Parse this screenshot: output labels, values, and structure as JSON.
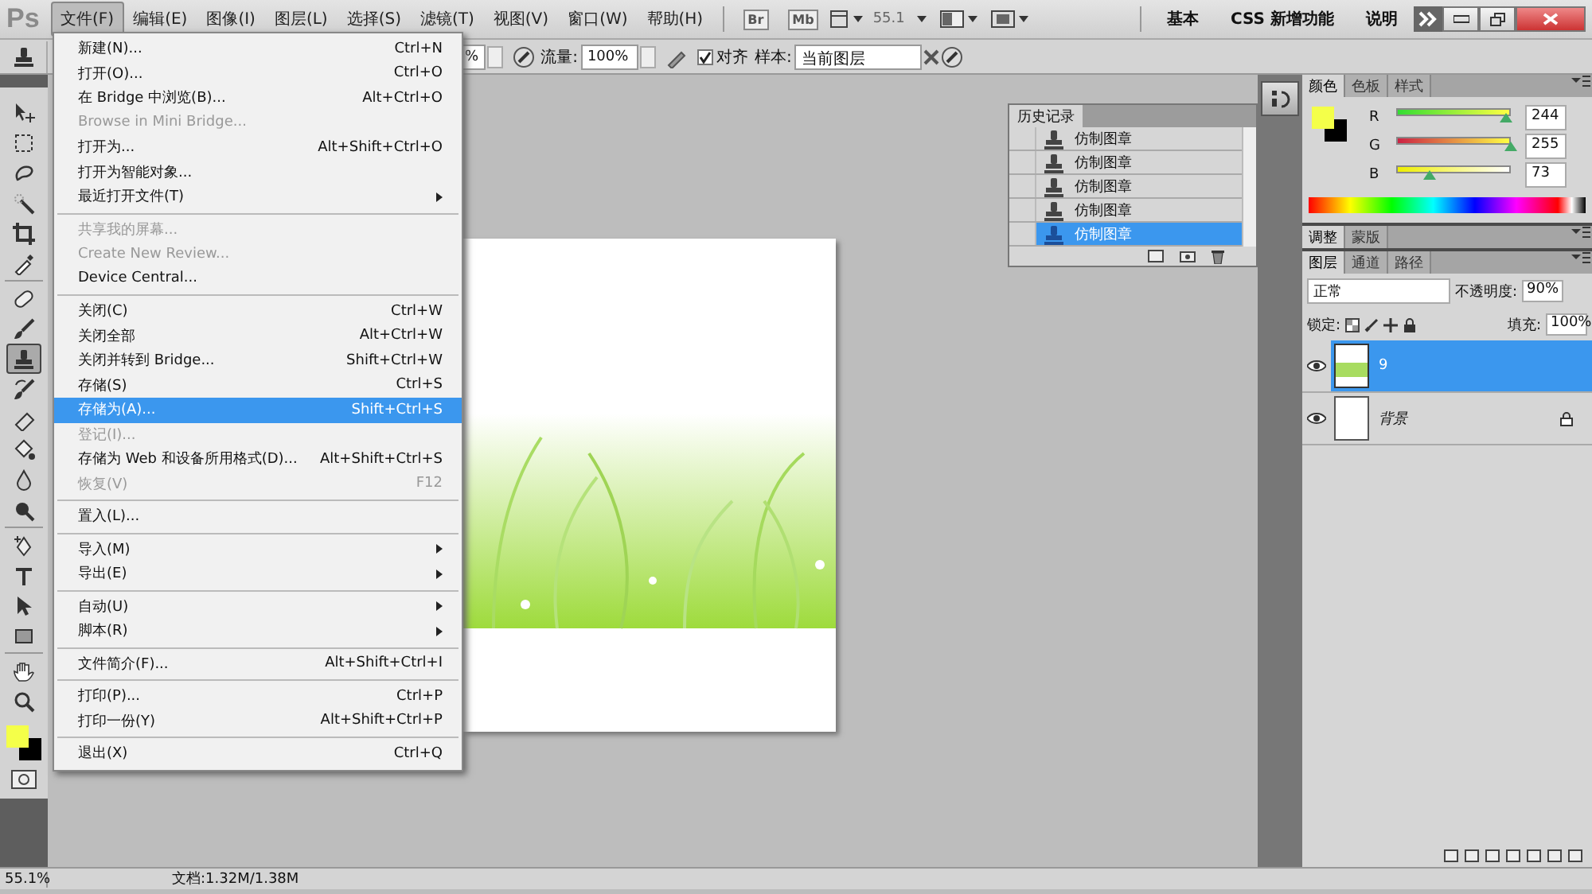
{
  "menubar": {
    "logo": "Ps",
    "menus": [
      {
        "label": "文件(F)",
        "selected": true
      },
      {
        "label": "编辑(E)",
        "selected": false
      },
      {
        "label": "图像(I)",
        "selected": false
      },
      {
        "label": "图层(L)",
        "selected": false
      },
      {
        "label": "选择(S)",
        "selected": false
      },
      {
        "label": "滤镜(T)",
        "selected": false
      },
      {
        "label": "视图(V)",
        "selected": false
      },
      {
        "label": "窗口(W)",
        "selected": false
      },
      {
        "label": "帮助(H)",
        "selected": false
      }
    ],
    "bridge": "Br",
    "mini_bridge": "Mb",
    "zoom": "55.1",
    "workspaces": [
      {
        "label": "基本"
      },
      {
        "label": "CSS 新增功能"
      },
      {
        "label": "说明"
      }
    ]
  },
  "options": {
    "partial_field": "%",
    "flow_label": "流量:",
    "flow": "100%",
    "align": {
      "label": "对齐",
      "checked": true
    },
    "sample_label": "样本:",
    "sample": "当前图层"
  },
  "file_menu": [
    {
      "kind": "item",
      "label": "新建(N)...",
      "shortcut": "Ctrl+N",
      "disabled": false,
      "submenu": false,
      "selected": false
    },
    {
      "kind": "item",
      "label": "打开(O)...",
      "shortcut": "Ctrl+O",
      "disabled": false,
      "submenu": false,
      "selected": false
    },
    {
      "kind": "item",
      "label": "在 Bridge 中浏览(B)...",
      "shortcut": "Alt+Ctrl+O",
      "disabled": false,
      "submenu": false,
      "selected": false
    },
    {
      "kind": "item",
      "label": "Browse in Mini Bridge...",
      "disabled": true,
      "submenu": false,
      "selected": false
    },
    {
      "kind": "item",
      "label": "打开为...",
      "shortcut": "Alt+Shift+Ctrl+O",
      "disabled": false,
      "submenu": false,
      "selected": false
    },
    {
      "kind": "item",
      "label": "打开为智能对象...",
      "disabled": false,
      "submenu": false,
      "selected": false
    },
    {
      "kind": "item",
      "label": "最近打开文件(T)",
      "disabled": false,
      "submenu": true,
      "selected": false
    },
    {
      "kind": "separator"
    },
    {
      "kind": "item",
      "label": "共享我的屏幕...",
      "disabled": true,
      "submenu": false,
      "selected": false
    },
    {
      "kind": "item",
      "label": "Create New Review...",
      "disabled": true,
      "submenu": false,
      "selected": false
    },
    {
      "kind": "item",
      "label": "Device Central...",
      "disabled": false,
      "submenu": false,
      "selected": false
    },
    {
      "kind": "separator"
    },
    {
      "kind": "item",
      "label": "关闭(C)",
      "shortcut": "Ctrl+W",
      "disabled": false,
      "submenu": false,
      "selected": false
    },
    {
      "kind": "item",
      "label": "关闭全部",
      "shortcut": "Alt+Ctrl+W",
      "disabled": false,
      "submenu": false,
      "selected": false
    },
    {
      "kind": "item",
      "label": "关闭并转到 Bridge...",
      "shortcut": "Shift+Ctrl+W",
      "disabled": false,
      "submenu": false,
      "selected": false
    },
    {
      "kind": "item",
      "label": "存储(S)",
      "shortcut": "Ctrl+S",
      "disabled": false,
      "submenu": false,
      "selected": false
    },
    {
      "kind": "item",
      "label": "存储为(A)...",
      "shortcut": "Shift+Ctrl+S",
      "disabled": false,
      "submenu": false,
      "selected": true
    },
    {
      "kind": "item",
      "label": "登记(I)...",
      "disabled": true,
      "submenu": false,
      "selected": false
    },
    {
      "kind": "item",
      "label": "存储为 Web 和设备所用格式(D)...",
      "shortcut": "Alt+Shift+Ctrl+S",
      "disabled": false,
      "submenu": false,
      "selected": false
    },
    {
      "kind": "item",
      "label": "恢复(V)",
      "shortcut": "F12",
      "disabled": true,
      "submenu": false,
      "selected": false
    },
    {
      "kind": "separator"
    },
    {
      "kind": "item",
      "label": "置入(L)...",
      "disabled": false,
      "submenu": false,
      "selected": false
    },
    {
      "kind": "separator"
    },
    {
      "kind": "item",
      "label": "导入(M)",
      "disabled": false,
      "submenu": true,
      "selected": false
    },
    {
      "kind": "item",
      "label": "导出(E)",
      "disabled": false,
      "submenu": true,
      "selected": false
    },
    {
      "kind": "separator"
    },
    {
      "kind": "item",
      "label": "自动(U)",
      "disabled": false,
      "submenu": true,
      "selected": false
    },
    {
      "kind": "item",
      "label": "脚本(R)",
      "disabled": false,
      "submenu": true,
      "selected": false
    },
    {
      "kind": "separator"
    },
    {
      "kind": "item",
      "label": "文件简介(F)...",
      "shortcut": "Alt+Shift+Ctrl+I",
      "disabled": false,
      "submenu": false,
      "selected": false
    },
    {
      "kind": "separator"
    },
    {
      "kind": "item",
      "label": "打印(P)...",
      "shortcut": "Ctrl+P",
      "disabled": false,
      "submenu": false,
      "selected": false
    },
    {
      "kind": "item",
      "label": "打印一份(Y)",
      "shortcut": "Alt+Shift+Ctrl+P",
      "disabled": false,
      "submenu": false,
      "selected": false
    },
    {
      "kind": "separator"
    },
    {
      "kind": "item",
      "label": "退出(X)",
      "shortcut": "Ctrl+Q",
      "disabled": false,
      "submenu": false,
      "selected": false
    }
  ],
  "toolbox": {
    "tools": [
      {
        "kind": "move",
        "selected": false
      },
      {
        "kind": "marquee",
        "selected": false
      },
      {
        "kind": "lasso",
        "selected": false
      },
      {
        "kind": "wand",
        "selected": false
      },
      {
        "kind": "crop",
        "selected": false
      },
      {
        "kind": "eyedropper",
        "selected": false
      },
      {
        "kind": "bandage",
        "selected": false
      },
      {
        "kind": "brush",
        "selected": false
      },
      {
        "kind": "stamp",
        "selected": true
      },
      {
        "kind": "historybrush",
        "selected": false
      },
      {
        "kind": "eraser",
        "selected": false
      },
      {
        "kind": "bucket",
        "selected": false
      },
      {
        "kind": "drop",
        "selected": false
      },
      {
        "kind": "dodge",
        "selected": false
      },
      {
        "kind": "pen",
        "selected": false
      },
      {
        "kind": "text",
        "selected": false
      },
      {
        "kind": "pathselect",
        "selected": false
      },
      {
        "kind": "rectangle",
        "selected": false
      },
      {
        "kind": "hand",
        "selected": false
      },
      {
        "kind": "zoom",
        "selected": false
      }
    ]
  },
  "history": {
    "title": "历史记录",
    "items": [
      {
        "label": "仿制图章",
        "selected": false
      },
      {
        "label": "仿制图章",
        "selected": false
      },
      {
        "label": "仿制图章",
        "selected": false
      },
      {
        "label": "仿制图章",
        "selected": false
      },
      {
        "label": "仿制图章",
        "selected": true
      }
    ]
  },
  "color_panel": {
    "tabs": [
      {
        "label": "颜色",
        "selected": true
      },
      {
        "label": "色板",
        "selected": false
      },
      {
        "label": "样式",
        "selected": false
      }
    ],
    "channels": [
      {
        "name": "R",
        "value": "244",
        "level": 0.957
      },
      {
        "name": "G",
        "value": "255",
        "level": 1
      },
      {
        "name": "B",
        "value": "73",
        "level": 0.286
      }
    ]
  },
  "adjust_panel": {
    "tabs": [
      {
        "label": "调整",
        "selected": true
      },
      {
        "label": "蒙版",
        "selected": false
      }
    ]
  },
  "layers_panel": {
    "tabs": [
      {
        "label": "图层",
        "selected": true
      },
      {
        "label": "通道",
        "selected": false
      },
      {
        "label": "路径",
        "selected": false
      }
    ],
    "blend_mode": "正常",
    "opacity_label": "不透明度:",
    "opacity": "90%",
    "lock_label": "锁定:",
    "fill_label": "填充:",
    "fill": "100%",
    "layers": [
      {
        "kind": "layer",
        "name": "9",
        "selected": true,
        "locked": false
      },
      {
        "kind": "background",
        "name": "背景",
        "selected": false,
        "locked": true
      }
    ]
  },
  "status_bar": {
    "zoom": "55.1%",
    "doc": "文档:1.32M/1.38M"
  }
}
